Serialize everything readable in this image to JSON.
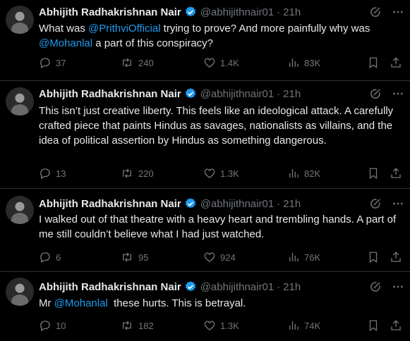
{
  "author": {
    "name": "Abhijith Radhakrishnan Nair",
    "time": "21h"
  },
  "tweets": [
    {
      "handle": "@abhijithnair01",
      "text_parts": [
        "What was ",
        "@PrithviOfficial",
        " trying to prove? And more painfully why was ",
        "@Mohanlal",
        " a part of this conspiracy?"
      ],
      "replies": "37",
      "reposts": "240",
      "likes": "1.4K",
      "views": "83K"
    },
    {
      "handle": "@abhijithnair01",
      "text": "This isn’t just creative liberty. This feels like an ideological attack. A carefully crafted piece that paints Hindus as savages, nationalists as villains, and the idea of political assertion by Hindus as something dangerous.",
      "replies": "13",
      "reposts": "220",
      "likes": "1.3K",
      "views": "82K"
    },
    {
      "handle": "@abhijithnair01",
      "text": "I walked out of that theatre with a heavy heart and trembling hands. A part of me still couldn’t believe what I had just watched.",
      "replies": "6",
      "reposts": "95",
      "likes": "924",
      "views": "76K"
    },
    {
      "handle": "@abhijithnair01",
      "text_parts": [
        "Mr ",
        "@Mohanlal",
        "  these hurts. This is betrayal."
      ],
      "replies": "10",
      "reposts": "182",
      "likes": "1.3K",
      "views": "74K"
    }
  ],
  "icons": {
    "reply": "reply-icon",
    "repost": "repost-icon",
    "like": "heart-icon",
    "views": "views-icon",
    "bookmark": "bookmark-icon",
    "share": "share-icon",
    "grok": "grok-icon",
    "more": "more-icon",
    "verified": "verified-badge-icon"
  },
  "colors": {
    "background": "#000000",
    "text": "#e7e9ea",
    "muted": "#71767b",
    "link": "#1d9bf0",
    "verified": "#1d9bf0"
  }
}
